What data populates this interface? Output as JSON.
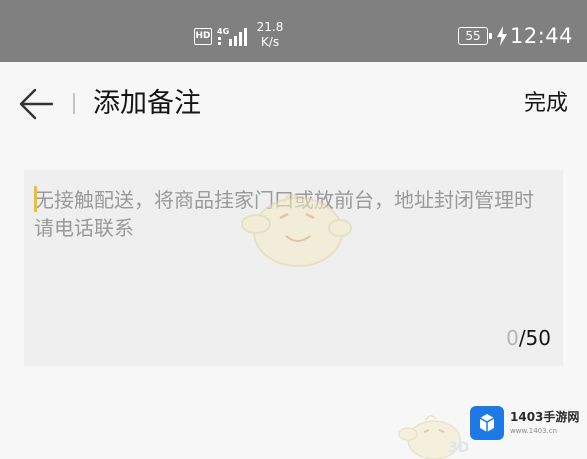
{
  "status_bar": {
    "hd_label": "HD",
    "signal_label": "4G",
    "net_speed_value": "21.8",
    "net_speed_unit": "K/s",
    "battery_level": "55",
    "time": "12:44"
  },
  "header": {
    "title": "添加备注",
    "done_label": "完成"
  },
  "note": {
    "placeholder": "无接触配送，将商品挂家门口或放前台，地址封闭管理时请电话联系",
    "value": "",
    "count_current": "0",
    "count_max_label": "/50"
  },
  "watermark": {
    "logo_text": "1403手游网",
    "logo_url_text": "www.1403.cn",
    "corner_text": "3D"
  },
  "colors": {
    "status_bar_bg": "#808080",
    "page_bg": "#f7f7f7",
    "input_bg": "#efefef",
    "cursor": "#f0c020",
    "logo_blue": "#1e79e4"
  },
  "icons": {
    "back": "back-arrow-icon",
    "signal": "signal-bars-icon",
    "charge": "lightning-icon"
  }
}
